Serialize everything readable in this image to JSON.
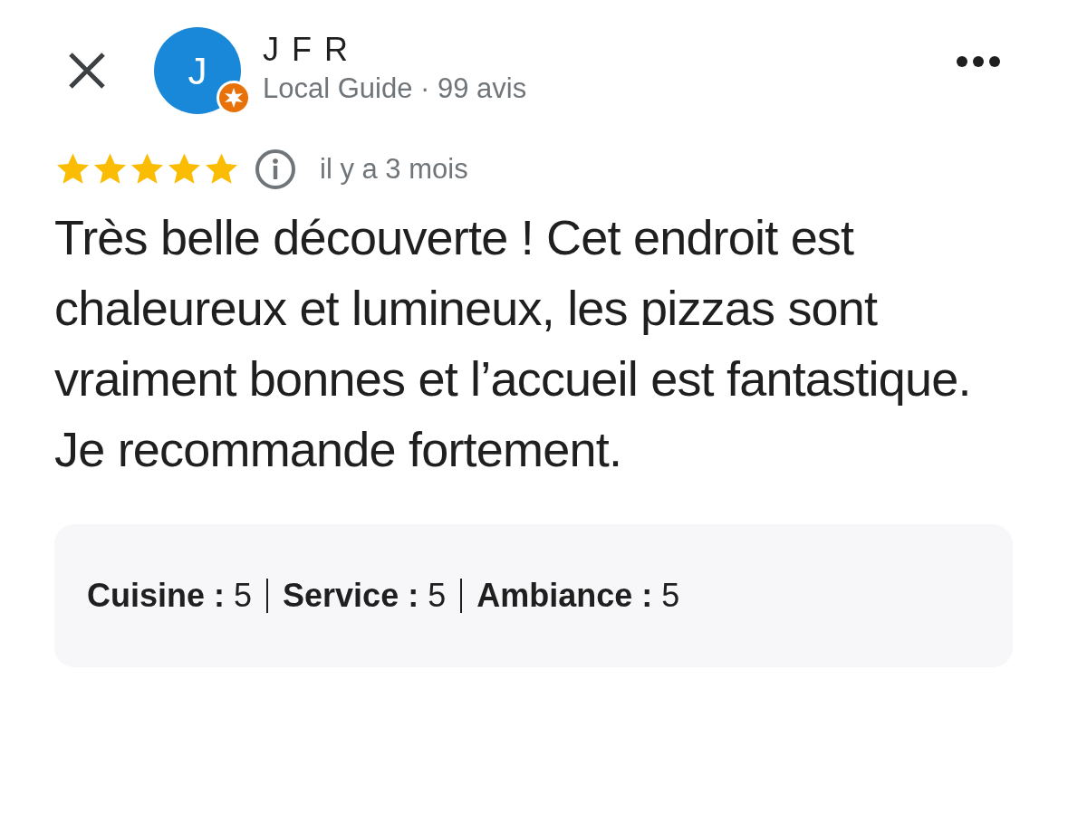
{
  "header": {
    "avatar_letter": "J",
    "name": "J F R",
    "subtitle": "Local Guide · 99 avis",
    "local_guide": true
  },
  "review": {
    "stars": 5,
    "time": "il y a 3 mois",
    "text": "Très belle découverte ! Cet endroit est chaleureux et lumineux, les pizzas sont vraiment bonnes et l’accueil est fantastique. Je recommande fortement."
  },
  "ratings": [
    {
      "label": "Cuisine :",
      "value": "5"
    },
    {
      "label": "Service :",
      "value": "5"
    },
    {
      "label": "Ambiance :",
      "value": "5"
    }
  ]
}
